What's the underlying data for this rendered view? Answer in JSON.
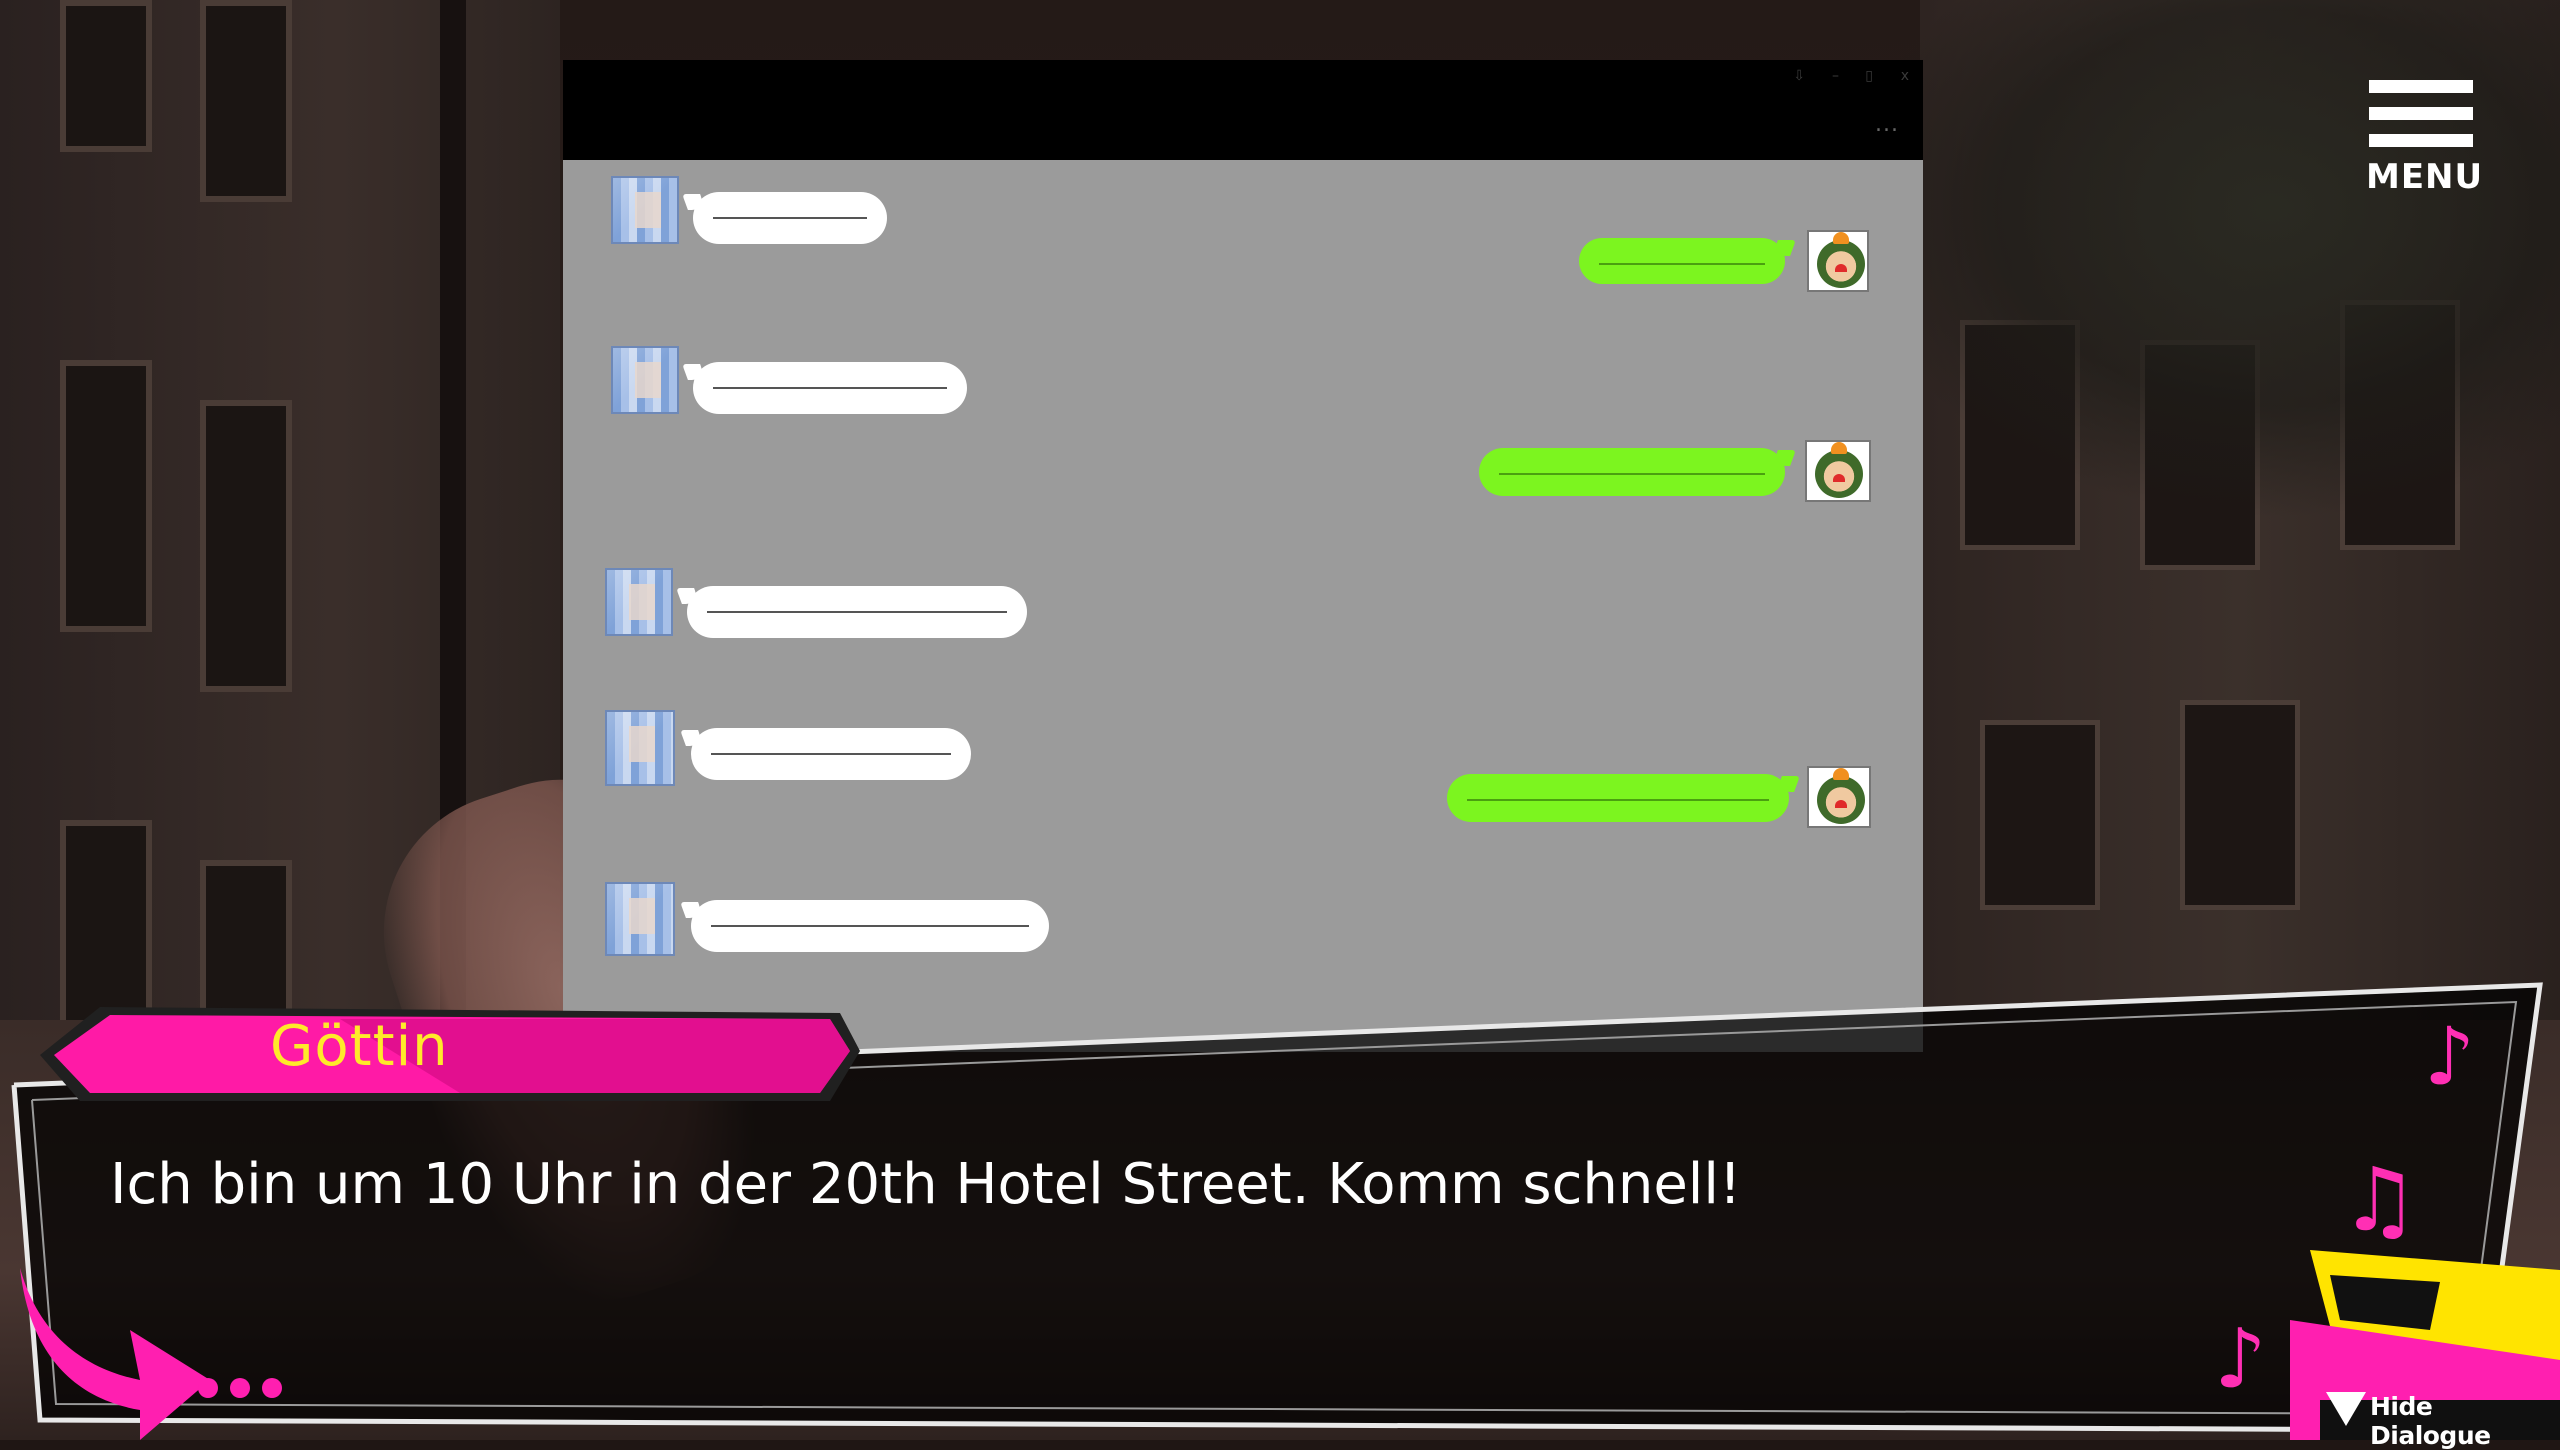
{
  "window_controls": [
    "⇩",
    "–",
    "▯",
    "x"
  ],
  "chat_more": "...",
  "menu": {
    "label": "MENU"
  },
  "dialogue": {
    "speaker": "Göttin",
    "text": "Ich bin um 10 Uhr in der 20th Hotel Street. Komm schnell!"
  },
  "hide_dialogue": {
    "label": "Hide Dialogue"
  },
  "chat_messages": [
    {
      "from": "other"
    },
    {
      "from": "self"
    },
    {
      "from": "other"
    },
    {
      "from": "self"
    },
    {
      "from": "other"
    },
    {
      "from": "other"
    },
    {
      "from": "self"
    },
    {
      "from": "other"
    },
    {
      "from": "other"
    }
  ],
  "colors": {
    "accent_pink": "#ff1fb0",
    "name_yellow": "#ffea2a",
    "out_bubble": "#7cf51f",
    "chat_bg": "#9b9b9b"
  },
  "icons": [
    "menu-hamburger-icon",
    "music-note-icon",
    "triangle-down-icon",
    "arrow-icon"
  ]
}
